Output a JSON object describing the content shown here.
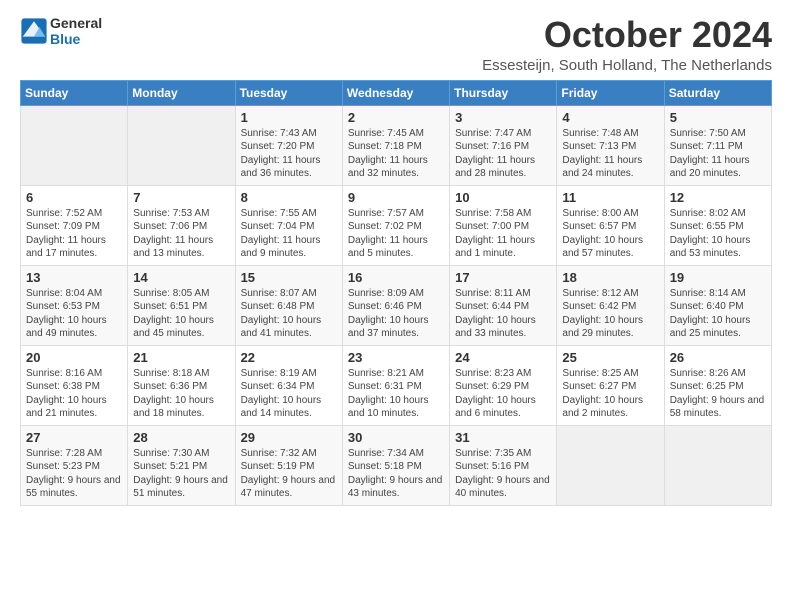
{
  "header": {
    "logo_line1": "General",
    "logo_line2": "Blue",
    "month": "October 2024",
    "location": "Essesteijn, South Holland, The Netherlands"
  },
  "weekdays": [
    "Sunday",
    "Monday",
    "Tuesday",
    "Wednesday",
    "Thursday",
    "Friday",
    "Saturday"
  ],
  "weeks": [
    [
      {
        "day": "",
        "info": ""
      },
      {
        "day": "",
        "info": ""
      },
      {
        "day": "1",
        "info": "Sunrise: 7:43 AM\nSunset: 7:20 PM\nDaylight: 11 hours and 36 minutes."
      },
      {
        "day": "2",
        "info": "Sunrise: 7:45 AM\nSunset: 7:18 PM\nDaylight: 11 hours and 32 minutes."
      },
      {
        "day": "3",
        "info": "Sunrise: 7:47 AM\nSunset: 7:16 PM\nDaylight: 11 hours and 28 minutes."
      },
      {
        "day": "4",
        "info": "Sunrise: 7:48 AM\nSunset: 7:13 PM\nDaylight: 11 hours and 24 minutes."
      },
      {
        "day": "5",
        "info": "Sunrise: 7:50 AM\nSunset: 7:11 PM\nDaylight: 11 hours and 20 minutes."
      }
    ],
    [
      {
        "day": "6",
        "info": "Sunrise: 7:52 AM\nSunset: 7:09 PM\nDaylight: 11 hours and 17 minutes."
      },
      {
        "day": "7",
        "info": "Sunrise: 7:53 AM\nSunset: 7:06 PM\nDaylight: 11 hours and 13 minutes."
      },
      {
        "day": "8",
        "info": "Sunrise: 7:55 AM\nSunset: 7:04 PM\nDaylight: 11 hours and 9 minutes."
      },
      {
        "day": "9",
        "info": "Sunrise: 7:57 AM\nSunset: 7:02 PM\nDaylight: 11 hours and 5 minutes."
      },
      {
        "day": "10",
        "info": "Sunrise: 7:58 AM\nSunset: 7:00 PM\nDaylight: 11 hours and 1 minute."
      },
      {
        "day": "11",
        "info": "Sunrise: 8:00 AM\nSunset: 6:57 PM\nDaylight: 10 hours and 57 minutes."
      },
      {
        "day": "12",
        "info": "Sunrise: 8:02 AM\nSunset: 6:55 PM\nDaylight: 10 hours and 53 minutes."
      }
    ],
    [
      {
        "day": "13",
        "info": "Sunrise: 8:04 AM\nSunset: 6:53 PM\nDaylight: 10 hours and 49 minutes."
      },
      {
        "day": "14",
        "info": "Sunrise: 8:05 AM\nSunset: 6:51 PM\nDaylight: 10 hours and 45 minutes."
      },
      {
        "day": "15",
        "info": "Sunrise: 8:07 AM\nSunset: 6:48 PM\nDaylight: 10 hours and 41 minutes."
      },
      {
        "day": "16",
        "info": "Sunrise: 8:09 AM\nSunset: 6:46 PM\nDaylight: 10 hours and 37 minutes."
      },
      {
        "day": "17",
        "info": "Sunrise: 8:11 AM\nSunset: 6:44 PM\nDaylight: 10 hours and 33 minutes."
      },
      {
        "day": "18",
        "info": "Sunrise: 8:12 AM\nSunset: 6:42 PM\nDaylight: 10 hours and 29 minutes."
      },
      {
        "day": "19",
        "info": "Sunrise: 8:14 AM\nSunset: 6:40 PM\nDaylight: 10 hours and 25 minutes."
      }
    ],
    [
      {
        "day": "20",
        "info": "Sunrise: 8:16 AM\nSunset: 6:38 PM\nDaylight: 10 hours and 21 minutes."
      },
      {
        "day": "21",
        "info": "Sunrise: 8:18 AM\nSunset: 6:36 PM\nDaylight: 10 hours and 18 minutes."
      },
      {
        "day": "22",
        "info": "Sunrise: 8:19 AM\nSunset: 6:34 PM\nDaylight: 10 hours and 14 minutes."
      },
      {
        "day": "23",
        "info": "Sunrise: 8:21 AM\nSunset: 6:31 PM\nDaylight: 10 hours and 10 minutes."
      },
      {
        "day": "24",
        "info": "Sunrise: 8:23 AM\nSunset: 6:29 PM\nDaylight: 10 hours and 6 minutes."
      },
      {
        "day": "25",
        "info": "Sunrise: 8:25 AM\nSunset: 6:27 PM\nDaylight: 10 hours and 2 minutes."
      },
      {
        "day": "26",
        "info": "Sunrise: 8:26 AM\nSunset: 6:25 PM\nDaylight: 9 hours and 58 minutes."
      }
    ],
    [
      {
        "day": "27",
        "info": "Sunrise: 7:28 AM\nSunset: 5:23 PM\nDaylight: 9 hours and 55 minutes."
      },
      {
        "day": "28",
        "info": "Sunrise: 7:30 AM\nSunset: 5:21 PM\nDaylight: 9 hours and 51 minutes."
      },
      {
        "day": "29",
        "info": "Sunrise: 7:32 AM\nSunset: 5:19 PM\nDaylight: 9 hours and 47 minutes."
      },
      {
        "day": "30",
        "info": "Sunrise: 7:34 AM\nSunset: 5:18 PM\nDaylight: 9 hours and 43 minutes."
      },
      {
        "day": "31",
        "info": "Sunrise: 7:35 AM\nSunset: 5:16 PM\nDaylight: 9 hours and 40 minutes."
      },
      {
        "day": "",
        "info": ""
      },
      {
        "day": "",
        "info": ""
      }
    ]
  ]
}
